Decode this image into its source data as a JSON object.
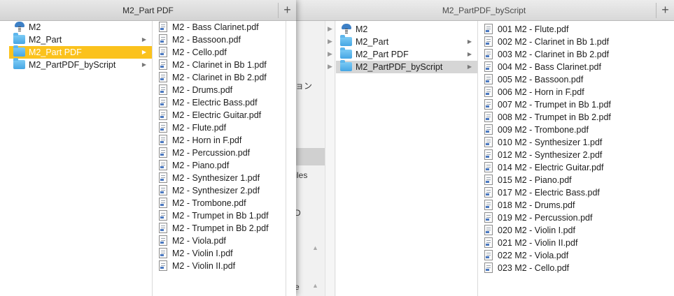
{
  "front": {
    "title": "M2_Part PDF",
    "plus": "+",
    "col1": [
      {
        "label": "M2",
        "icon": "m2"
      },
      {
        "label": "M2_Part",
        "icon": "folder",
        "arrow": true
      },
      {
        "label": "M2_Part PDF",
        "icon": "folder",
        "arrow": true,
        "selected": true
      },
      {
        "label": "M2_PartPDF_byScript",
        "icon": "folder",
        "arrow": true
      }
    ],
    "files": [
      "M2 - Bass Clarinet.pdf",
      "M2 - Bassoon.pdf",
      "M2 - Cello.pdf",
      "M2 - Clarinet in Bb 1.pdf",
      "M2 - Clarinet in Bb 2.pdf",
      "M2 - Drums.pdf",
      "M2 - Electric Bass.pdf",
      "M2 - Electric Guitar.pdf",
      "M2 - Flute.pdf",
      "M2 - Horn in F.pdf",
      "M2 - Percussion.pdf",
      "M2 - Piano.pdf",
      "M2 - Synthesizer 1.pdf",
      "M2 - Synthesizer 2.pdf",
      "M2 - Trombone.pdf",
      "M2 - Trumpet in Bb 1.pdf",
      "M2 - Trumpet in Bb 2.pdf",
      "M2 - Viola.pdf",
      "M2 - Violin I.pdf",
      "M2 - Violin II.pdf"
    ]
  },
  "back": {
    "title": "M2_PartPDF_byScript",
    "plus": "+",
    "fragments": {
      "jp": "ョン",
      "files": "Files",
      "d": "D",
      "e": "e"
    },
    "col1": [
      {
        "label": "M2",
        "icon": "m2"
      },
      {
        "label": "M2_Part",
        "icon": "folder",
        "arrow": true
      },
      {
        "label": "M2_Part PDF",
        "icon": "folder",
        "arrow": true
      },
      {
        "label": "M2_PartPDF_byScript",
        "icon": "folder",
        "arrow": true,
        "selected": true
      }
    ],
    "files": [
      "001 M2 - Flute.pdf",
      "002 M2 - Clarinet in Bb 1.pdf",
      "003 M2 - Clarinet in Bb 2.pdf",
      "004 M2 - Bass Clarinet.pdf",
      "005 M2 - Bassoon.pdf",
      "006 M2 - Horn in F.pdf",
      "007 M2 - Trumpet in Bb 1.pdf",
      "008 M2 - Trumpet in Bb 2.pdf",
      "009 M2 - Trombone.pdf",
      "010 M2 - Synthesizer 1.pdf",
      "012 M2 - Synthesizer 2.pdf",
      "014 M2 - Electric Guitar.pdf",
      "015 M2 - Piano.pdf",
      "017 M2 - Electric Bass.pdf",
      "018 M2 - Drums.pdf",
      "019 M2 - Percussion.pdf",
      "020 M2 - Violin I.pdf",
      "021 M2 - Violin II.pdf",
      "022 M2 - Viola.pdf",
      "023 M2 - Cello.pdf"
    ]
  },
  "colors": {
    "selection_active": "#fbc21d",
    "selection_inactive": "#d6d6d6",
    "folder": "#46a6e4"
  }
}
